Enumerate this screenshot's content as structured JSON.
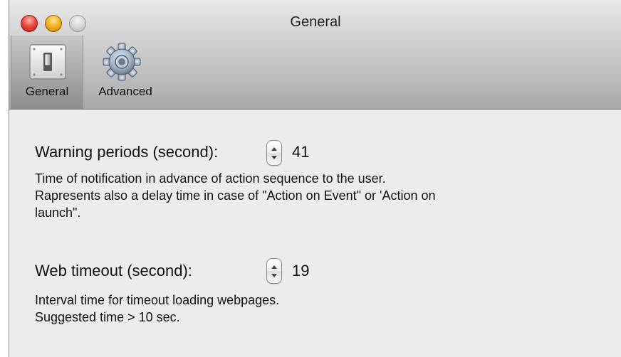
{
  "window": {
    "title": "General"
  },
  "toolbar": {
    "items": [
      {
        "label": "General",
        "icon": "switch-icon",
        "selected": true
      },
      {
        "label": "Advanced",
        "icon": "gear-icon",
        "selected": false
      }
    ]
  },
  "settings": {
    "warning": {
      "label": "Warning periods (second):",
      "value": "41",
      "description": [
        "Time of notification in advance of action sequence to the user.",
        "Rapresents also a delay time in case of \"Action on Event\" or 'Action on",
        "launch\"."
      ]
    },
    "web_timeout": {
      "label": "Web timeout (second):",
      "value": "19",
      "description": [
        "Interval time for timeout loading webpages.",
        "Suggested time > 10 sec."
      ]
    }
  },
  "colors": {
    "close": "#ef4b41",
    "minimize": "#f5b321",
    "zoom": "#d3d3d3",
    "window_bg": "#ececec"
  }
}
